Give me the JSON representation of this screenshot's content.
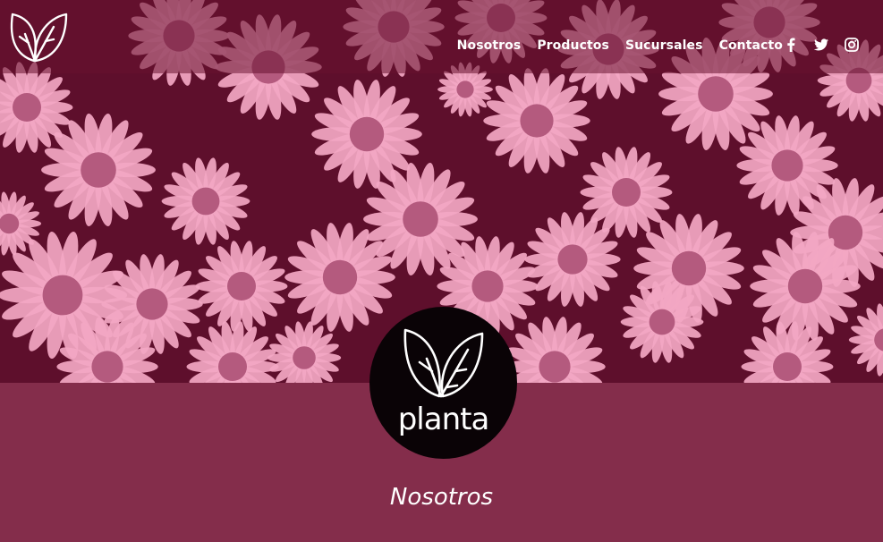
{
  "colors": {
    "brand_plum": "#842d4b",
    "hero_dark": "#5e0f2c",
    "petal_pink": "#f3a7c3",
    "flower_center": "#b45a7e",
    "logo_black": "#0a0306"
  },
  "header": {
    "brand_icon": "leaf-logo-icon",
    "nav": {
      "items": [
        {
          "label": "Nosotros"
        },
        {
          "label": "Productos"
        },
        {
          "label": "Sucursales"
        },
        {
          "label": "Contacto"
        }
      ]
    },
    "social": [
      "facebook-icon",
      "twitter-icon",
      "instagram-icon"
    ]
  },
  "hero": {
    "image": "daisy-field-image"
  },
  "logo": {
    "text": "planta",
    "icon": "leaf-logo-icon"
  },
  "section": {
    "title": "Nosotros"
  }
}
